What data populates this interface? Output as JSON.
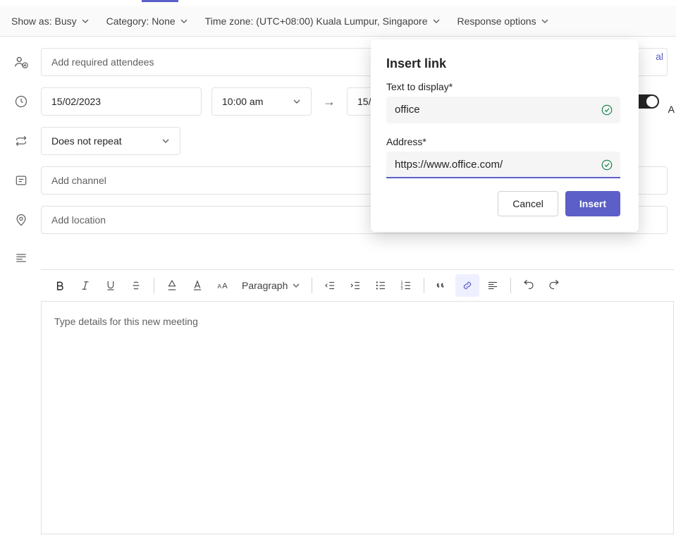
{
  "options": {
    "show_as": "Show as: Busy",
    "category": "Category: None",
    "time_zone": "Time zone: (UTC+08:00) Kuala Lumpur, Singapore",
    "response": "Response options"
  },
  "attendees": {
    "placeholder": "Add required attendees",
    "optional_label": "al"
  },
  "datetime": {
    "start_date": "15/02/2023",
    "start_time": "10:00 am",
    "end_date": "15/02/",
    "all_day_label": "A"
  },
  "recurrence": {
    "label": "Does not repeat"
  },
  "channel": {
    "placeholder": "Add channel"
  },
  "location": {
    "placeholder": "Add location"
  },
  "toolbar": {
    "paragraph": "Paragraph"
  },
  "editor": {
    "placeholder": "Type details for this new meeting"
  },
  "modal": {
    "title": "Insert link",
    "text_label": "Text to display*",
    "text_value": "office",
    "address_label": "Address*",
    "address_value": "https://www.office.com/",
    "cancel": "Cancel",
    "insert": "Insert"
  }
}
